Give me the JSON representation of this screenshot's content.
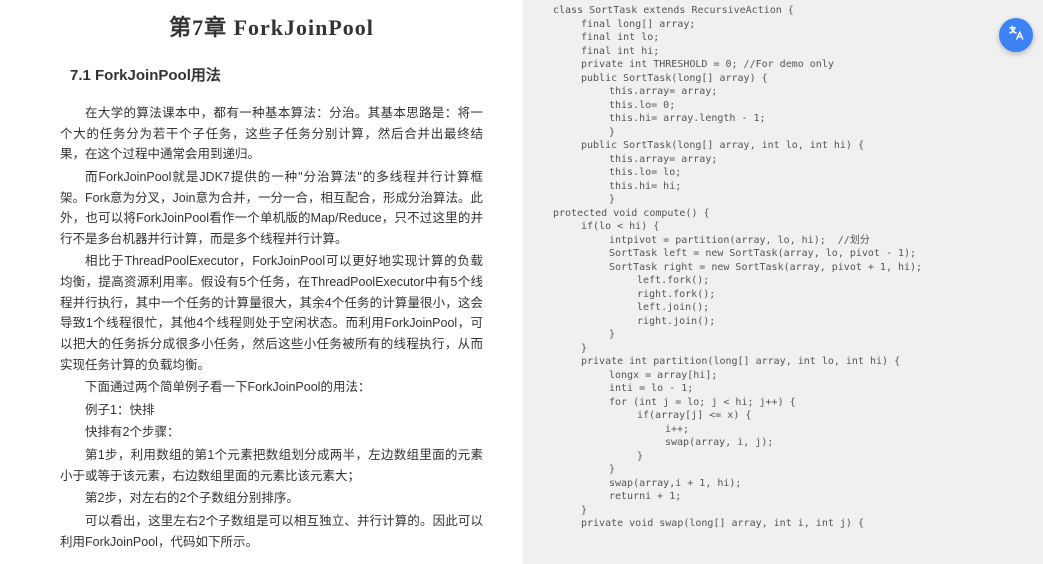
{
  "chapter": {
    "title": "第7章 ForkJoinPool"
  },
  "section": {
    "title": "7.1 ForkJoinPool用法"
  },
  "paragraphs": {
    "p1": "在大学的算法课本中，都有一种基本算法：分治。其基本思路是：将一个大的任务分为若干个子任务，这些子任务分别计算，然后合并出最终结果，在这个过程中通常会用到递归。",
    "p2": "而ForkJoinPool就是JDK7提供的一种\"分治算法\"的多线程并行计算框架。Fork意为分叉，Join意为合并，一分一合，相互配合，形成分治算法。此外，也可以将ForkJoinPool看作一个单机版的Map/Reduce，只不过这里的并行不是多台机器并行计算，而是多个线程并行计算。",
    "p3": "相比于ThreadPoolExecutor，ForkJoinPool可以更好地实现计算的负载均衡，提高资源利用率。假设有5个任务，在ThreadPoolExecutor中有5个线程并行执行，其中一个任务的计算量很大，其余4个任务的计算量很小，这会导致1个线程很忙，其他4个线程则处于空闲状态。而利用ForkJoinPool，可以把大的任务拆分成很多小任务，然后这些小任务被所有的线程执行，从而实现任务计算的负载均衡。",
    "p4": "下面通过两个简单例子看一下ForkJoinPool的用法：",
    "p5": "例子1：快排",
    "p6": "快排有2个步骤：",
    "p7": "第1步，利用数组的第1个元素把数组划分成两半，左边数组里面的元素小于或等于该元素，右边数组里面的元素比该元素大；",
    "p8": "第2步，对左右的2个子数组分别排序。",
    "p9": "可以看出，这里左右2个子数组是可以相互独立、并行计算的。因此可以利用ForkJoinPool，代码如下所示。"
  },
  "code": {
    "l0": "class SortTask extends RecursiveAction {",
    "l1": "final long[] array;",
    "l2": "final int lo;",
    "l3": "final int hi;",
    "l4": "private int THRESHOLD = 0; //For demo only",
    "l5": "public SortTask(long[] array) {",
    "l6": "this.array= array;",
    "l7": "this.lo= 0;",
    "l8": "this.hi= array.length - 1;",
    "l9": "}",
    "l10": "public SortTask(long[] array, int lo, int hi) {",
    "l11": "this.array= array;",
    "l12": "this.lo= lo;",
    "l13": "this.hi= hi;",
    "l14": "}",
    "l15": "protected void compute() {",
    "l16": "if(lo < hi) {",
    "l17": "intpivot = partition(array, lo, hi);  //划分",
    "l18": "SortTask left = new SortTask(array, lo, pivot - 1);",
    "l19": "SortTask right = new SortTask(array, pivot + 1, hi);",
    "l20": "left.fork();",
    "l21": "right.fork();",
    "l22": "left.join();",
    "l23": "right.join();",
    "l24": "}",
    "l25": "}",
    "l26": "private int partition(long[] array, int lo, int hi) {",
    "l27": "longx = array[hi];",
    "l28": "inti = lo - 1;",
    "l29": "for (int j = lo; j < hi; j++) {",
    "l30": "if(array[j] <= x) {",
    "l31": "i++;",
    "l32": "swap(array, i, j);",
    "l33": "}",
    "l34": "}",
    "l35": "swap(array,i + 1, hi);",
    "l36": "returni + 1;",
    "l37": "}",
    "l38": "private void swap(long[] array, int i, int j) {"
  },
  "fab": {
    "name": "translate-icon"
  }
}
